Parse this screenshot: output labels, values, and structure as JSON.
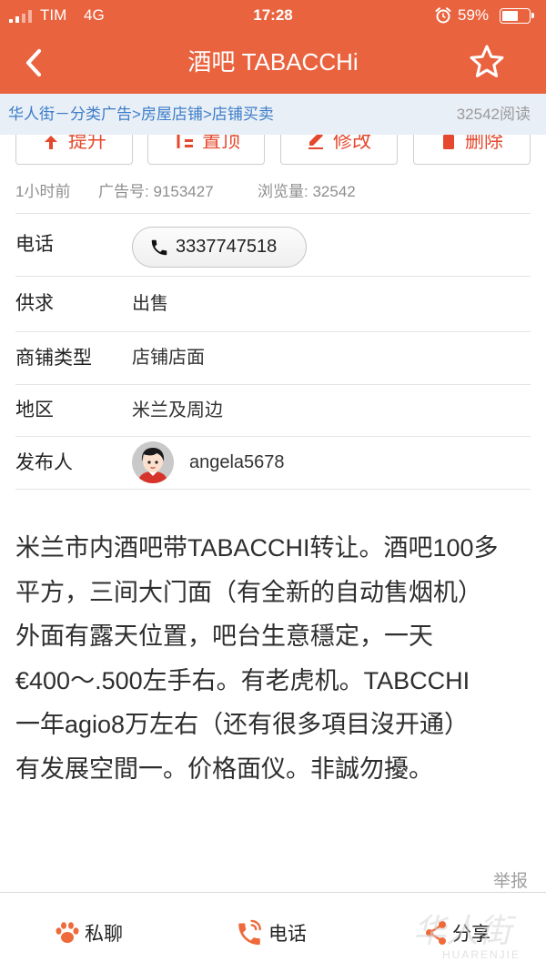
{
  "status_bar": {
    "carrier": "TIM",
    "network": "4G",
    "time": "17:28",
    "battery_text": "59%",
    "battery_level": 0.59,
    "icons": [
      "signal-icon",
      "alarm-icon",
      "battery-icon"
    ]
  },
  "header": {
    "back_icon": "chevron-left-icon",
    "title": "酒吧 TABACCHi",
    "favorite_icon": "star-icon"
  },
  "breadcrumb": {
    "items": [
      "华人街－分类广告",
      "房屋店铺",
      "店铺买卖"
    ],
    "separator": ">",
    "reads": "32542阅读"
  },
  "actions": [
    {
      "label": "提升",
      "icon": "boost-icon"
    },
    {
      "label": "置顶",
      "icon": "pin-top-icon"
    },
    {
      "label": "修改",
      "icon": "edit-icon"
    },
    {
      "label": "删除",
      "icon": "trash-icon"
    }
  ],
  "meta": {
    "posted": "1小时前",
    "ad_id_label": "广告号:",
    "ad_id": "9153427",
    "views_label": "浏览量:",
    "views": "32542"
  },
  "details": {
    "phone": {
      "label": "电话",
      "value": "3337747518",
      "icon": "phone-icon"
    },
    "supply": {
      "label": "供求",
      "value": "出售"
    },
    "shop_type": {
      "label": "商铺类型",
      "value": "店铺店面"
    },
    "region": {
      "label": "地区",
      "value": "米兰及周边"
    },
    "publisher": {
      "label": "发布人",
      "value": "angela5678",
      "icon": "avatar"
    }
  },
  "description": {
    "lines": [
      "米兰市内酒吧带TABACCHI转让。酒吧100多",
      "平方，三间大门面（有全新的自动售烟机）",
      "外面有露天位置，吧台生意穩定，一天",
      "€400～.500左手右。有老虎机。TABCCHI",
      "一年agio8万左右（还有很多項目沒开通）",
      "有发展空間一。价格面仪。非誠勿擾。"
    ]
  },
  "report_label": "举报",
  "bottom_bar": {
    "chat": {
      "label": "私聊",
      "icon": "paw-icon"
    },
    "call": {
      "label": "电话",
      "icon": "phone-icon"
    },
    "share": {
      "label": "分享",
      "icon": "share-icon"
    }
  },
  "watermark": {
    "logo": "华人街",
    "text": "HUARENJIE"
  },
  "colors": {
    "accent": "#EA633F",
    "link": "#3C7DC8",
    "action": "#E5482C",
    "icon_accent": "#EE6A3A",
    "muted": "#8E8E8E"
  }
}
